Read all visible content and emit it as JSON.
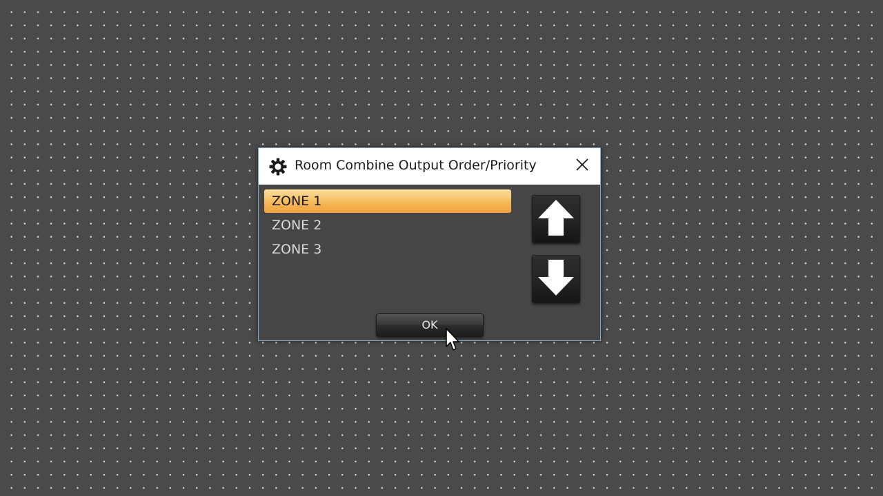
{
  "dialog": {
    "title": "Room Combine Output Order/Priority",
    "title_icon": "gear-icon",
    "close_icon": "close-icon"
  },
  "zones": {
    "items": [
      {
        "label": "ZONE 1",
        "selected": true
      },
      {
        "label": "ZONE 2",
        "selected": false
      },
      {
        "label": "ZONE 3",
        "selected": false
      }
    ]
  },
  "buttons": {
    "move_up_icon": "arrow-up-icon",
    "move_down_icon": "arrow-down-icon",
    "ok_label": "OK"
  },
  "colors": {
    "selection_gradient_top": "#fbe0a0",
    "selection_gradient_bottom": "#f1a23d",
    "dialog_border": "#7fa9c7",
    "background": "#4a4a4a"
  }
}
